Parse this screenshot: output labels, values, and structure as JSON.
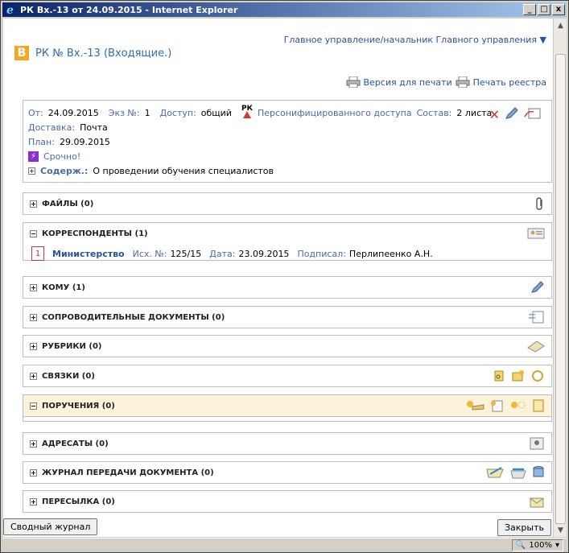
{
  "window": {
    "title": "РК Вх.-13 от 24.09.2015 - Internet Explorer",
    "buttons": {
      "minimize": "_",
      "maximize": "□",
      "close": "x"
    }
  },
  "header": {
    "top_link": "Главное управление/начальник Главного управления ▼",
    "badge": "В",
    "rk_title": "РК № Вх.-13 (Входящие.)",
    "print_version": "Версия для печати",
    "print_registry": "Печать реестра"
  },
  "info": {
    "from_label": "От:",
    "from_value": "24.09.2015",
    "ekz_label": "Экз №:",
    "ekz_value": "1",
    "access_label": "Доступ:",
    "access_value": "общий",
    "rk_mark": "РК",
    "personal_access": "Персонифицированного доступа",
    "sostav_label": "Состав:",
    "sostav_value": "2 листа",
    "delivery_label": "Доставка:",
    "delivery_value": "Почта",
    "plan_label": "План:",
    "plan_value": "29.09.2015",
    "urgent": "Срочно!",
    "content_label": "Содерж.:",
    "content_value": "О проведении обучения специалистов"
  },
  "sections": {
    "files": "ФАЙЛЫ (0)",
    "correspondents": "КОРРЕСПОНДЕНТЫ (1)",
    "komu": "КОМУ (1)",
    "soprovod": "СОПРОВОДИТЕЛЬНЫЕ ДОКУМЕНТЫ (0)",
    "rubriki": "РУБРИКИ (0)",
    "svyazki": "СВЯЗКИ (0)",
    "porucheniya": "ПОРУЧЕНИЯ (0)",
    "adresaty": "АДРЕСАТЫ (0)",
    "zhurnal": "ЖУРНАЛ ПЕРЕДАЧИ ДОКУМЕНТА (0)",
    "peresylka": "ПЕРЕСЫЛКА (0)"
  },
  "correspondent": {
    "num": "1",
    "name": "Министерство",
    "isx_label": "Исх. №:",
    "isx_value": "125/15",
    "date_label": "Дата:",
    "date_value": "23.09.2015",
    "signed_label": "Подписал:",
    "signed_value": "Перлипеенко А.Н."
  },
  "footer": {
    "summary_button": "Сводный журнал",
    "close_button": "Закрыть",
    "zoom": "100%"
  },
  "colors": {
    "accent": "#2753a2",
    "badge": "#f5a623",
    "highlight": "#fbf3da",
    "danger": "#d6342c"
  }
}
